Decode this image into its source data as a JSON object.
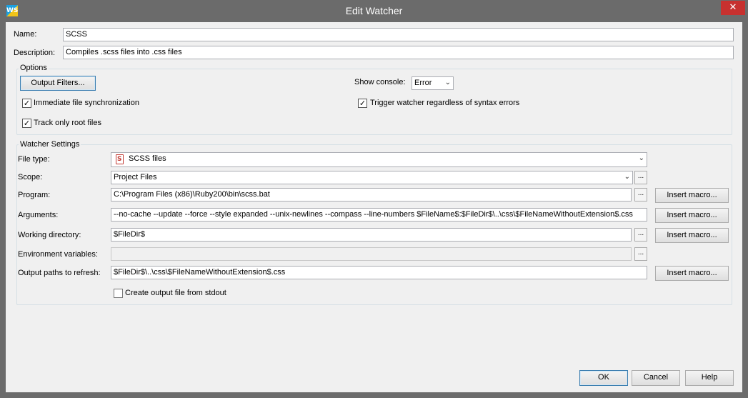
{
  "window": {
    "title": "Edit Watcher",
    "app_icon": "WS",
    "close_glyph": "✕"
  },
  "name": {
    "label": "Name:",
    "value": "SCSS"
  },
  "description": {
    "label": "Description:",
    "value": "Compiles .scss files into .css files"
  },
  "options": {
    "title": "Options",
    "output_filters_label": "Output Filters...",
    "show_console_label": "Show console:",
    "show_console_value": "Error",
    "immediate_sync": {
      "label": "Immediate file synchronization",
      "checked": true
    },
    "track_root": {
      "label": "Track only root files",
      "checked": true
    },
    "trigger_watcher": {
      "label": "Trigger watcher regardless of syntax errors",
      "checked": true
    }
  },
  "watcher": {
    "title": "Watcher Settings",
    "file_type": {
      "label": "File type:",
      "value": "SCSS files",
      "icon": "scss-file-icon"
    },
    "scope": {
      "label": "Scope:",
      "value": "Project Files"
    },
    "program": {
      "label": "Program:",
      "value": "C:\\Program Files (x86)\\Ruby200\\bin\\scss.bat"
    },
    "arguments": {
      "label": "Arguments:",
      "value": "--no-cache --update --force --style expanded --unix-newlines --compass --line-numbers $FileName$:$FileDir$\\..\\css\\$FileNameWithoutExtension$.css"
    },
    "working_dir": {
      "label": "Working directory:",
      "value": "$FileDir$"
    },
    "env_vars": {
      "label": "Environment variables:",
      "value": ""
    },
    "output_paths": {
      "label": "Output paths to refresh:",
      "value": "$FileDir$\\..\\css\\$FileNameWithoutExtension$.css"
    },
    "stdout": {
      "label": "Create output file from stdout",
      "checked": false
    },
    "insert_macro_label": "Insert macro...",
    "browse_label": "..."
  },
  "footer": {
    "ok_label": "OK",
    "cancel_label": "Cancel",
    "help_label": "Help"
  },
  "glyphs": {
    "check": "✓",
    "chevron": "⌄"
  }
}
